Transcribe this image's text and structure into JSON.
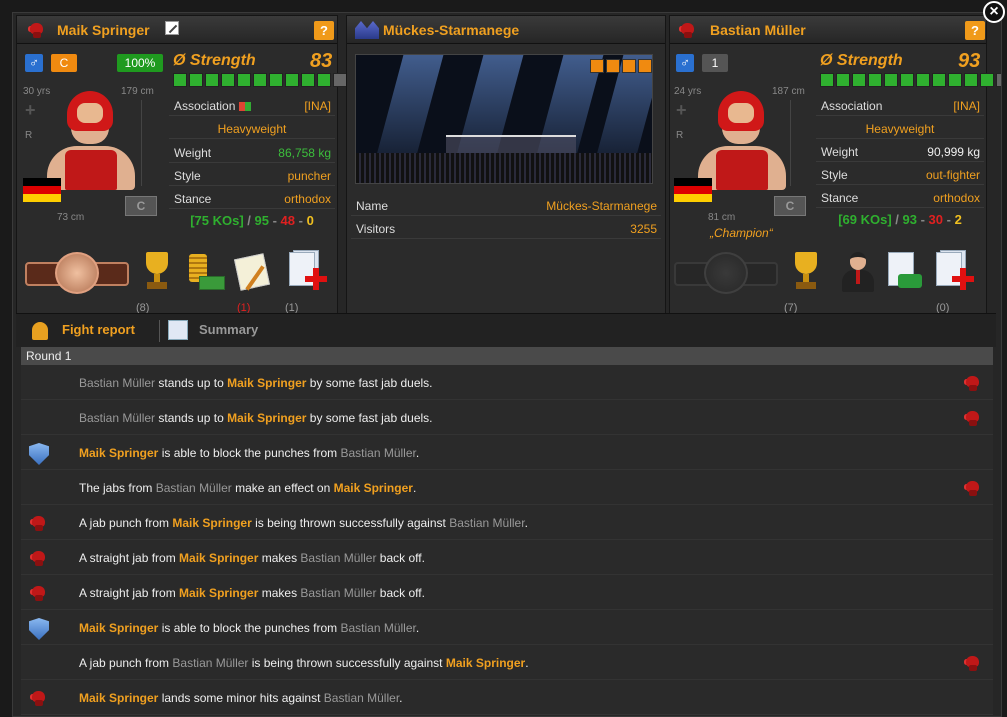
{
  "close_label": "×",
  "left_fighter": {
    "name": "Maik Springer",
    "help": "?",
    "gender_symbol": "♂",
    "rank": "C",
    "condition": "100%",
    "age": "30 yrs",
    "height": "179 cm",
    "reach": "73 cm",
    "reset_label": "C",
    "side_label": "R",
    "strength_label": "Ø Strength",
    "strength_value": "83",
    "strength_bars": 10,
    "strength_bar_total": 12,
    "association_label": "Association",
    "association_value": "[INA]",
    "weight_class": "Heavyweight",
    "weight_label": "Weight",
    "weight_value": "86,758 kg",
    "style_label": "Style",
    "style_value": "puncher",
    "stance_label": "Stance",
    "stance_value": "orthodox",
    "record": {
      "kos": "[75 KOs]",
      "wins": "95",
      "losses": "48",
      "draws": "0"
    },
    "trophies_count": "(8)",
    "contracts_count": "(1)",
    "documents_count": "(1)"
  },
  "arena": {
    "name": "Mückes-Starmanege",
    "stars": 4,
    "stars_total": 5,
    "name_label": "Name",
    "name_value": "Mückes-Starmanege",
    "visitors_label": "Visitors",
    "visitors_value": "3255"
  },
  "right_fighter": {
    "name": "Bastian Müller",
    "help": "?",
    "gender_symbol": "♂",
    "rank": "1",
    "age": "24 yrs",
    "height": "187 cm",
    "reach": "81 cm",
    "reset_label": "C",
    "side_label": "R",
    "title": "„Champion“",
    "strength_label": "Ø Strength",
    "strength_value": "93",
    "strength_bars": 11,
    "strength_bar_total": 12,
    "association_label": "Association",
    "association_value": "[INA]",
    "weight_class": "Heavyweight",
    "weight_label": "Weight",
    "weight_value": "90,999 kg",
    "style_label": "Style",
    "style_value": "out-fighter",
    "stance_label": "Stance",
    "stance_value": "orthodox",
    "record": {
      "kos": "[69 KOs]",
      "wins": "93",
      "losses": "30",
      "draws": "2"
    },
    "trophies_count": "(7)",
    "documents_count": "(0)"
  },
  "record_sep": " / ",
  "record_dash": " - ",
  "tabs": {
    "report": "Fight report",
    "summary": "Summary"
  },
  "round_label": "Round 1",
  "events": [
    {
      "icon": "right-glove",
      "parts": [
        [
          "g",
          "Bastian Müller"
        ],
        [
          "t",
          " stands up to "
        ],
        [
          "b",
          "Maik Springer"
        ],
        [
          "t",
          " by some fast jab duels."
        ]
      ]
    },
    {
      "icon": "right-glove",
      "parts": [
        [
          "g",
          "Bastian Müller"
        ],
        [
          "t",
          " stands up to "
        ],
        [
          "b",
          "Maik Springer"
        ],
        [
          "t",
          " by some fast jab duels."
        ]
      ]
    },
    {
      "icon": "left-shield",
      "parts": [
        [
          "b",
          "Maik Springer"
        ],
        [
          "t",
          " is able to block the punches from "
        ],
        [
          "g",
          "Bastian Müller"
        ],
        [
          "t",
          "."
        ]
      ]
    },
    {
      "icon": "right-glove",
      "parts": [
        [
          "t",
          "The jabs from "
        ],
        [
          "g",
          "Bastian Müller"
        ],
        [
          "t",
          " make an effect on "
        ],
        [
          "b",
          "Maik Springer"
        ],
        [
          "t",
          "."
        ]
      ]
    },
    {
      "icon": "left-glove",
      "parts": [
        [
          "t",
          "A jab punch from "
        ],
        [
          "b",
          "Maik Springer"
        ],
        [
          "t",
          " is being thrown successfully against "
        ],
        [
          "g",
          "Bastian Müller"
        ],
        [
          "t",
          "."
        ]
      ]
    },
    {
      "icon": "left-glove",
      "parts": [
        [
          "t",
          "A straight jab from "
        ],
        [
          "b",
          "Maik Springer"
        ],
        [
          "t",
          " makes "
        ],
        [
          "g",
          "Bastian Müller"
        ],
        [
          "t",
          " back off."
        ]
      ]
    },
    {
      "icon": "left-glove",
      "parts": [
        [
          "t",
          "A straight jab from "
        ],
        [
          "b",
          "Maik Springer"
        ],
        [
          "t",
          " makes "
        ],
        [
          "g",
          "Bastian Müller"
        ],
        [
          "t",
          " back off."
        ]
      ]
    },
    {
      "icon": "left-shield",
      "parts": [
        [
          "b",
          "Maik Springer"
        ],
        [
          "t",
          " is able to block the punches from "
        ],
        [
          "g",
          "Bastian Müller"
        ],
        [
          "t",
          "."
        ]
      ]
    },
    {
      "icon": "right-glove",
      "parts": [
        [
          "t",
          "A jab punch from "
        ],
        [
          "g",
          "Bastian Müller"
        ],
        [
          "t",
          " is being thrown successfully against "
        ],
        [
          "b",
          "Maik Springer"
        ],
        [
          "t",
          "."
        ]
      ]
    },
    {
      "icon": "left-glove",
      "parts": [
        [
          "b",
          "Maik Springer"
        ],
        [
          "t",
          " lands some minor hits against "
        ],
        [
          "g",
          "Bastian Müller"
        ],
        [
          "t",
          "."
        ]
      ]
    }
  ],
  "colors": {
    "accent": "#f0a020",
    "green": "#2fb02f",
    "red": "#e02020",
    "panel": "#2b2b2b"
  }
}
